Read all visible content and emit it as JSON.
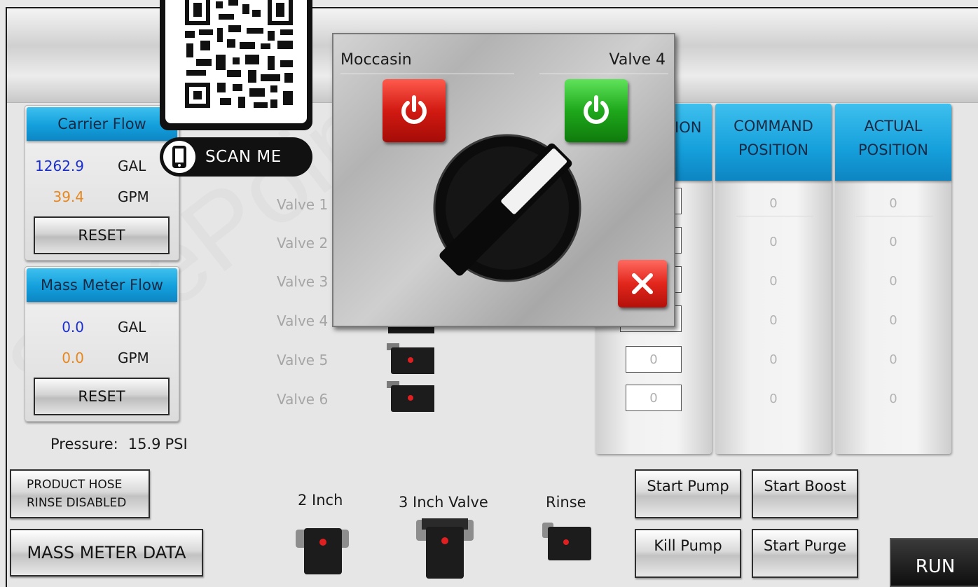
{
  "carrier_flow": {
    "title": "Carrier Flow",
    "volume_value": "1262.9",
    "volume_unit": "GAL",
    "rate_value": "39.4",
    "rate_unit": "GPM",
    "reset_label": "RESET"
  },
  "mass_meter_flow": {
    "title": "Mass Meter Flow",
    "volume_value": "0.0",
    "volume_unit": "GAL",
    "rate_value": "0.0",
    "rate_unit": "GPM",
    "reset_label": "RESET"
  },
  "pressure": {
    "label": "Pressure:",
    "value": "15.9",
    "unit": "PSI"
  },
  "buttons": {
    "hose_line1": "PRODUCT HOSE",
    "hose_line2": "RINSE DISABLED",
    "mass_meter_data": "MASS METER DATA",
    "start_pump": "Start Pump",
    "start_boost": "Start Boost",
    "kill_pump": "Kill Pump",
    "start_purge": "Start Purge",
    "run": "RUN"
  },
  "valves": {
    "labels": [
      "Valve 1",
      "Valve 2",
      "Valve 3",
      "Valve 4",
      "Valve 5",
      "Valve 6"
    ]
  },
  "bottom_valves": {
    "two_inch": "2 Inch",
    "three_inch": "3 Inch Valve",
    "rinse": "Rinse"
  },
  "table": {
    "col1_header_partial": "ION",
    "command_header_line1": "COMMAND",
    "command_header_line2": "POSITION",
    "actual_header_line1": "ACTUAL",
    "actual_header_line2": "POSITION",
    "position_inputs": [
      "0",
      "0"
    ],
    "command_values": [
      "0",
      "0",
      "0",
      "0",
      "0",
      "0"
    ],
    "actual_values": [
      "0",
      "0",
      "0",
      "0",
      "0",
      "0"
    ]
  },
  "modal": {
    "title_left": "Moccasin",
    "title_right": "Valve 4"
  },
  "qr": {
    "scan_label": "SCAN ME"
  },
  "colors": {
    "header_blue": "#139fdc",
    "value_blue": "#1b2fcf",
    "value_orange": "#e8871e",
    "power_red": "#d21a12",
    "power_green": "#1fa81b"
  }
}
